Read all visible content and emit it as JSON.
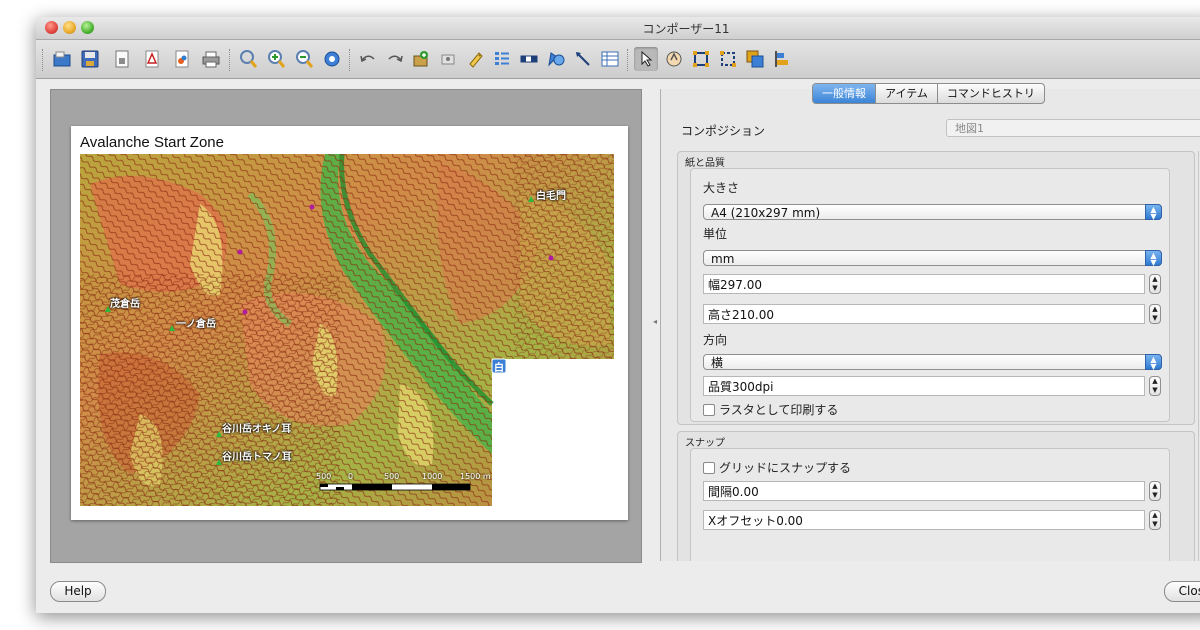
{
  "window": {
    "title": "コンポーザー11"
  },
  "toolbar": {
    "icons": [
      "add-map-icon",
      "save-icon",
      "new-composer-icon",
      "export-pdf-icon",
      "export-svg-icon",
      "print-icon",
      "zoom-full-icon",
      "zoom-in-icon",
      "zoom-out-icon",
      "refresh-icon",
      "undo-icon",
      "redo-icon",
      "add-new-map-icon",
      "add-image-icon",
      "add-label-icon",
      "add-legend-icon",
      "add-scalebar-icon",
      "add-shape-icon",
      "add-arrow-icon",
      "add-table-icon",
      "select-move-icon",
      "move-content-icon",
      "group-icon",
      "ungroup-icon",
      "raise-icon",
      "align-icon"
    ]
  },
  "map": {
    "title": "Avalanche Start Zone",
    "labels": {
      "peak1": "白毛門",
      "peak2": "茂倉岳",
      "peak3": "一ノ倉岳",
      "peak4": "谷川岳オキノ耳",
      "peak5": "谷川岳トマノ耳"
    },
    "scalebar": {
      "ticks": [
        "500",
        "0",
        "500",
        "1000",
        "1500 m"
      ]
    },
    "item_marker": "白"
  },
  "panel": {
    "tabs": [
      "一般情報",
      "アイテム",
      "コマンドヒストリ"
    ],
    "selected_tab": "一般情報",
    "composition_label": "コンポジション",
    "composition_value": "地図1",
    "paper_group": {
      "title": "紙と品質",
      "size_label": "大きさ",
      "size_value": "A4 (210x297 mm)",
      "unit_label": "単位",
      "unit_value": "mm",
      "width_value": "幅297.00",
      "height_value": "高さ210.00",
      "orientation_label": "方向",
      "orientation_value": "横",
      "quality_value": "品質300dpi",
      "raster_label": "ラスタとして印刷する"
    },
    "snap_group": {
      "title": "スナップ",
      "snap_label": "グリッドにスナップする",
      "spacing_value": "間隔0.00",
      "xoffset_value": "Xオフセット0.00"
    }
  },
  "buttons": {
    "help": "Help",
    "close": "Close"
  }
}
